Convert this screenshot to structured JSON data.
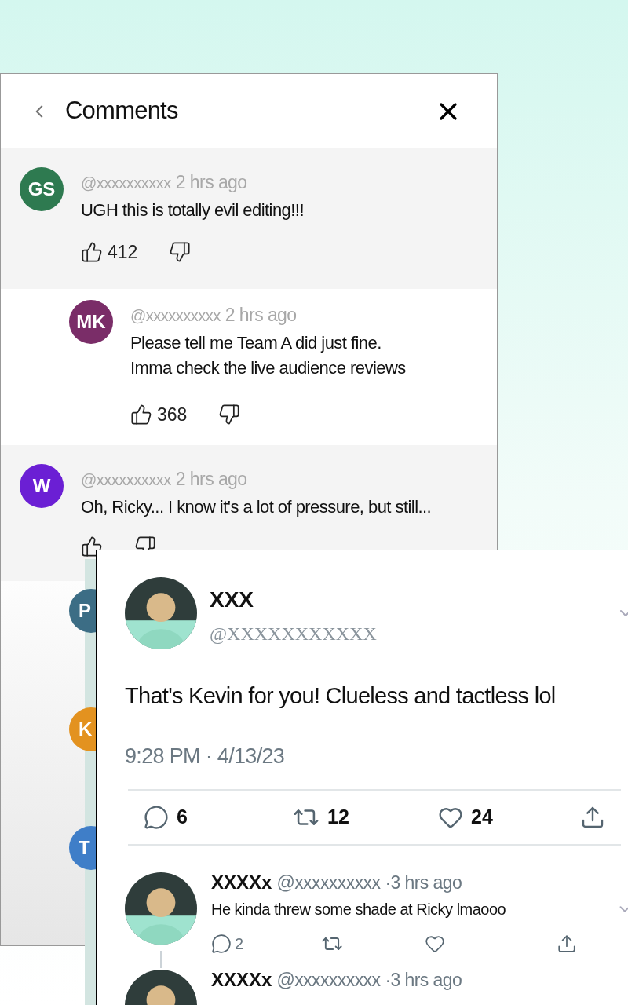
{
  "comments_panel": {
    "title": "Comments",
    "comments": [
      {
        "kind": "top",
        "initials": "GS",
        "color": "#2e7a50",
        "handle": "@xxxxxxxxxx",
        "time": "2 hrs ago",
        "text": "UGH this is totally evil editing!!!",
        "likes": "412"
      },
      {
        "kind": "reply",
        "initials": "MK",
        "color": "#7a2d68",
        "handle": "@xxxxxxxxxx",
        "time": "2 hrs ago",
        "text": "Please tell me Team A did just fine.\nImma check the live audience reviews",
        "likes": "368"
      },
      {
        "kind": "top",
        "initials": "W",
        "color": "#6b1fd4",
        "handle": "@xxxxxxxxxx",
        "time": "2 hrs ago",
        "text": "Oh, Ricky... I know it's a lot of pressure, but still..."
      },
      {
        "kind": "hidden",
        "initials": "P",
        "color": "#3c6d85"
      },
      {
        "kind": "hidden",
        "initials": "K",
        "color": "#e3921f"
      },
      {
        "kind": "hidden",
        "initials": "T",
        "color": "#3f7ec8"
      }
    ]
  },
  "tweet": {
    "name": "XXX",
    "handle": "@XXXXXXXXXXX",
    "text": "That's Kevin for you! Clueless and tactless lol",
    "timestamp": "9:28 PM · 4/13/23",
    "replies": "6",
    "retweets": "12",
    "likes": "24",
    "thread": [
      {
        "name": "XXXXx",
        "handle": "@xxxxxxxxxx",
        "time": "·3 hrs ago",
        "text": "He kinda threw some shade at Ricky lmaooo",
        "replies": "2"
      },
      {
        "name": "XXXXx",
        "handle": "@xxxxxxxxxx",
        "time": "·3 hrs ago"
      }
    ]
  }
}
